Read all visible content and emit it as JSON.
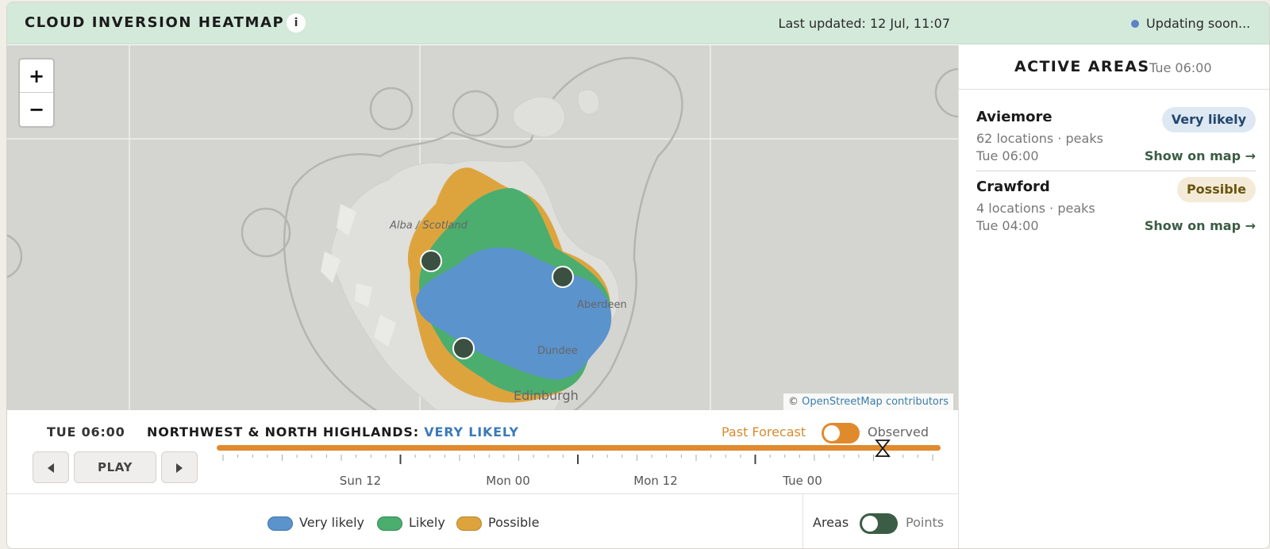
{
  "header": {
    "title": "CLOUD INVERSION HEATMAP",
    "info_label": "i",
    "last_updated": "Last updated: 12 Jul, 11:07",
    "status": "Updating soon...",
    "status_color": "#5b83c6"
  },
  "map": {
    "zoom_in": "+",
    "zoom_out": "−",
    "labels": {
      "scotland": "Alba / Scotland",
      "aberdeen": "Aberdeen",
      "dundee": "Dundee",
      "edinburgh": "Edinburgh"
    },
    "attribution_prefix": "©",
    "attribution_link": "OpenStreetMap contributors"
  },
  "timeline": {
    "current_time": "TUE 06:00",
    "region_label": "NORTHWEST & NORTH HIGHLANDS:",
    "region_level": "VERY LIKELY",
    "past_forecast_label": "Past Forecast",
    "observed_label": "Observed",
    "prev_icon": "triangle-left-icon",
    "play_label": "PLAY",
    "next_icon": "triangle-right-icon",
    "tick_labels": [
      "Sun 12",
      "Mon 00",
      "Mon 12",
      "Tue 00"
    ],
    "progress": 0.92
  },
  "legend": {
    "items": [
      {
        "label": "Very likely",
        "color": "#5b93cc"
      },
      {
        "label": "Likely",
        "color": "#4bae6f"
      },
      {
        "label": "Possible",
        "color": "#dda43e"
      }
    ],
    "areas_label": "Areas",
    "points_label": "Points"
  },
  "sidebar": {
    "title": "ACTIVE AREAS",
    "time": "Tue 06:00",
    "cards": [
      {
        "name": "Aviemore",
        "count": "62 locations · peaks",
        "time": "Tue 06:00",
        "badge": "Very likely",
        "link": "Show on map →"
      },
      {
        "name": "Crawford",
        "count": "4 locations · peaks",
        "time": "Tue 04:00",
        "badge": "Possible",
        "link": "Show on map →"
      }
    ]
  }
}
